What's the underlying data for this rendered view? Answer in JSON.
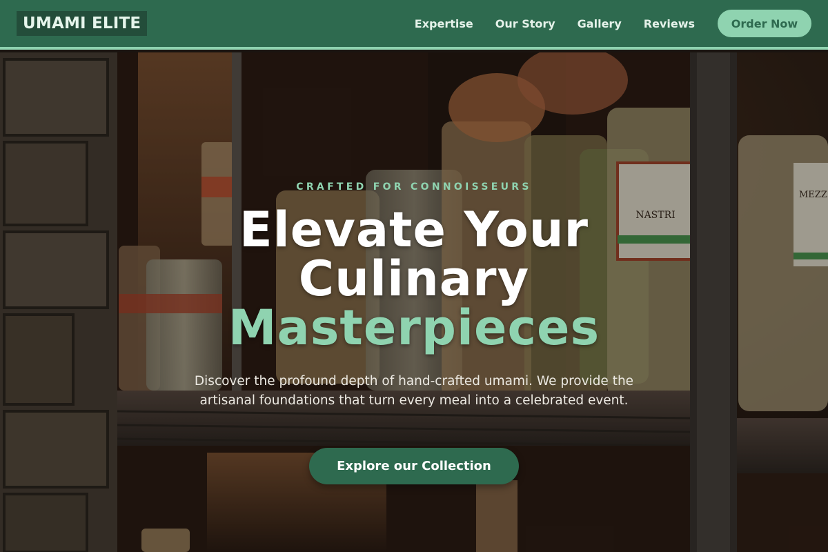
{
  "nav": {
    "logo": "UMAMI ELITE",
    "links": [
      "Expertise",
      "Our Story",
      "Gallery",
      "Reviews"
    ],
    "order_label": "Order Now"
  },
  "hero": {
    "eyebrow": "CRAFTED FOR CONNOISSEURS",
    "headline_line1": "Elevate Your",
    "headline_line2": "Culinary",
    "headline_accent": "Masterpieces",
    "subtext": "Discover the profound depth of hand-crafted umami. We provide the artisanal foundations that turn every meal into a celebrated event.",
    "cta_label": "Explore our Collection",
    "label_nastri": "NASTRI",
    "label_mezze": "MEZZ"
  },
  "colors": {
    "primary": "#2e6a4f",
    "accent": "#8fd3b0",
    "logo_bg": "#234d3a"
  }
}
